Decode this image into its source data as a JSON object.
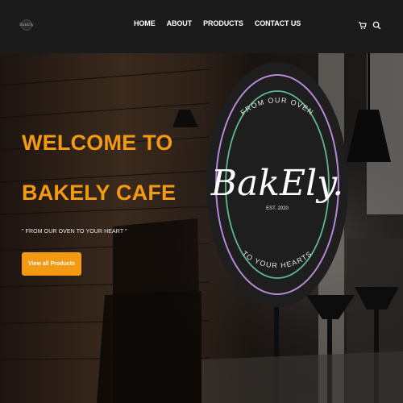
{
  "nav": {
    "logo_text": "BakEly",
    "links": [
      "HOME",
      "ABOUT",
      "PRODUCTS",
      "CONTACT US"
    ],
    "icons": [
      "cart-icon",
      "search-icon"
    ]
  },
  "hero": {
    "title_line1": "WELCOME TO",
    "title_line2": "BAKELY CAFE",
    "tagline": "\" FROM OUR OVEN TO YOUR HEART \"",
    "cta_label": "View all Products",
    "accent_color": "#f39a12"
  },
  "seal": {
    "top_text": "FROM OUR OVEN",
    "brand": "BakEly.",
    "est": "EST. 2020",
    "bottom_text": "TO YOUR HEARTS"
  }
}
